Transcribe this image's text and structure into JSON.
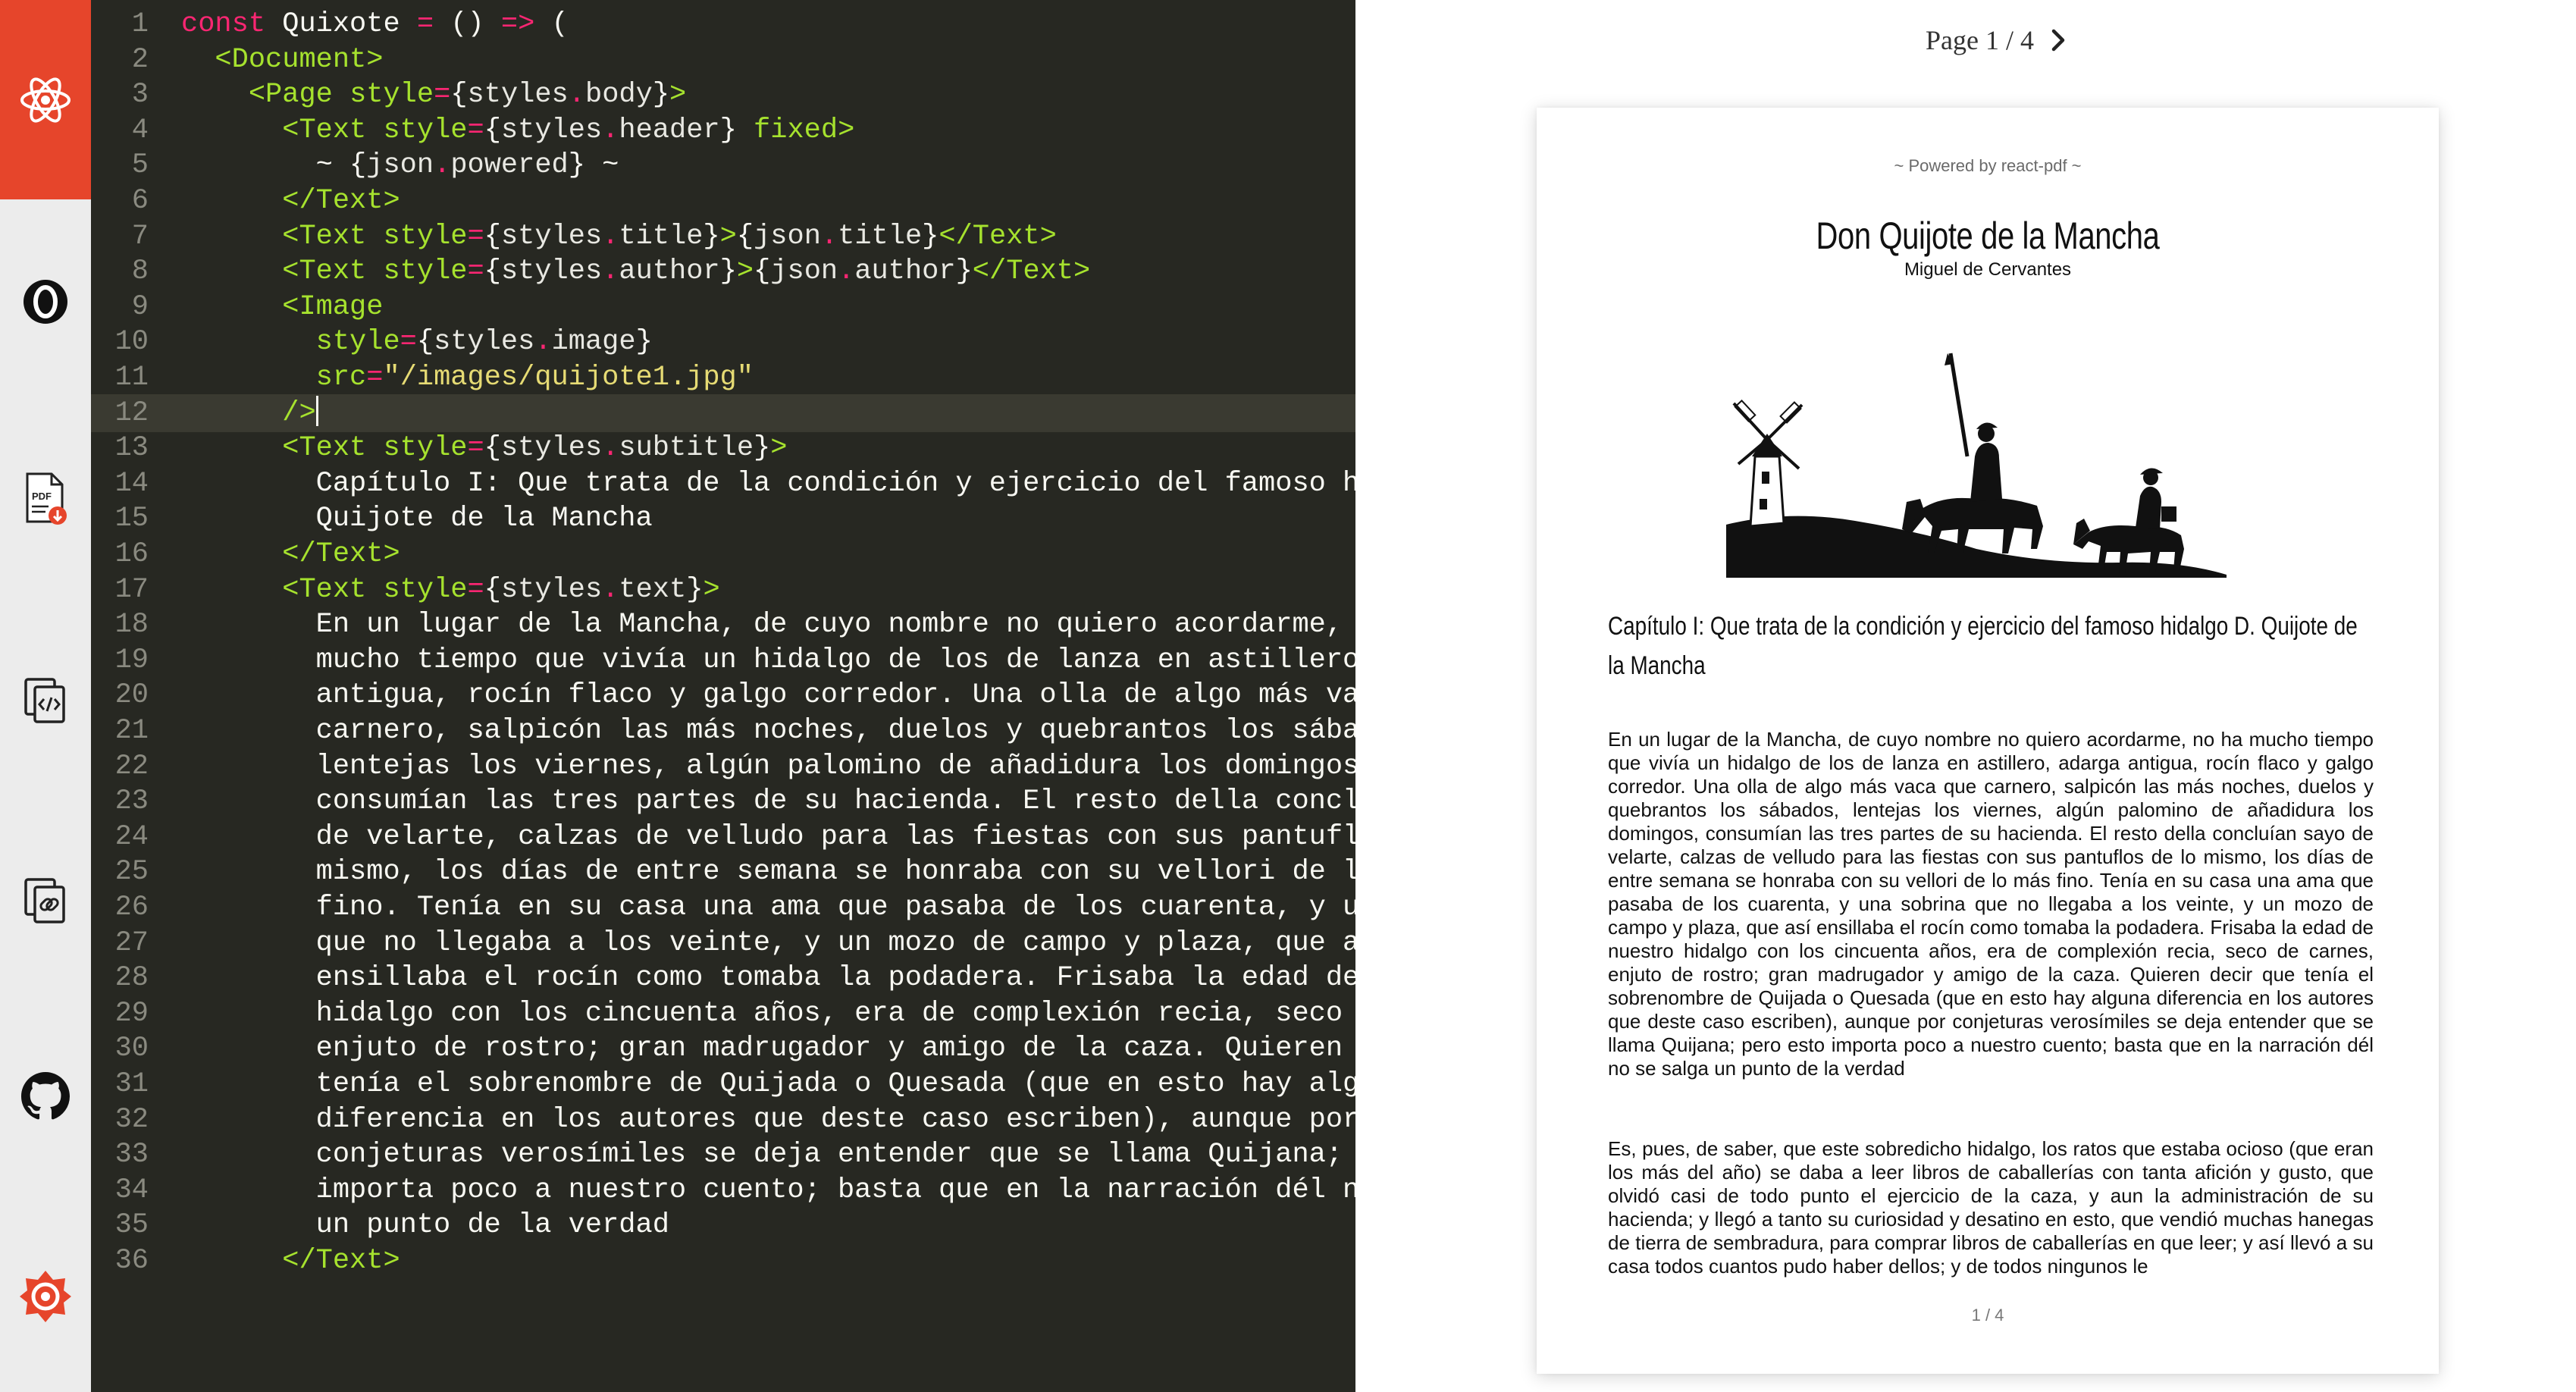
{
  "sidebar": {
    "items": [
      {
        "name": "react-logo",
        "icon": "react-icon"
      },
      {
        "name": "opencollective",
        "icon": "opencollective-icon"
      },
      {
        "name": "download-pdf",
        "icon": "pdf-download-icon"
      },
      {
        "name": "copy-code",
        "icon": "copy-code-icon"
      },
      {
        "name": "copy-link",
        "icon": "copy-link-icon"
      },
      {
        "name": "github",
        "icon": "github-icon"
      },
      {
        "name": "react-pdf-logo",
        "icon": "react-pdf-logo-icon"
      }
    ],
    "accent_color": "#e6452b"
  },
  "editor": {
    "active_line": 12,
    "lines": [
      {
        "n": "1",
        "t": [
          [
            "kw",
            "const"
          ],
          [
            "plain",
            " Quixote "
          ],
          [
            "op",
            "="
          ],
          [
            "plain",
            " () "
          ],
          [
            "op",
            "=>"
          ],
          [
            "plain",
            " ("
          ]
        ]
      },
      {
        "n": "2",
        "t": [
          [
            "plain",
            "  "
          ],
          [
            "tag",
            "<Document>"
          ]
        ]
      },
      {
        "n": "3",
        "t": [
          [
            "plain",
            "    "
          ],
          [
            "tag",
            "<Page "
          ],
          [
            "attr",
            "style"
          ],
          [
            "op",
            "="
          ],
          [
            "punc",
            "{"
          ],
          [
            "var",
            "styles"
          ],
          [
            "op",
            "."
          ],
          [
            "var",
            "body"
          ],
          [
            "punc",
            "}"
          ],
          [
            "tag",
            ">"
          ]
        ]
      },
      {
        "n": "4",
        "t": [
          [
            "plain",
            "      "
          ],
          [
            "tag",
            "<Text "
          ],
          [
            "attr",
            "style"
          ],
          [
            "op",
            "="
          ],
          [
            "punc",
            "{"
          ],
          [
            "var",
            "styles"
          ],
          [
            "op",
            "."
          ],
          [
            "var",
            "header"
          ],
          [
            "punc",
            "}"
          ],
          [
            "attr",
            " fixed"
          ],
          [
            "tag",
            ">"
          ]
        ]
      },
      {
        "n": "5",
        "t": [
          [
            "plain",
            "        ~ "
          ],
          [
            "punc",
            "{"
          ],
          [
            "var",
            "json"
          ],
          [
            "op",
            "."
          ],
          [
            "var",
            "powered"
          ],
          [
            "punc",
            "}"
          ],
          [
            "plain",
            " ~"
          ]
        ]
      },
      {
        "n": "6",
        "t": [
          [
            "plain",
            "      "
          ],
          [
            "tag",
            "</Text>"
          ]
        ]
      },
      {
        "n": "7",
        "t": [
          [
            "plain",
            "      "
          ],
          [
            "tag",
            "<Text "
          ],
          [
            "attr",
            "style"
          ],
          [
            "op",
            "="
          ],
          [
            "punc",
            "{"
          ],
          [
            "var",
            "styles"
          ],
          [
            "op",
            "."
          ],
          [
            "var",
            "title"
          ],
          [
            "punc",
            "}"
          ],
          [
            "tag",
            ">"
          ],
          [
            "punc",
            "{"
          ],
          [
            "var",
            "json"
          ],
          [
            "op",
            "."
          ],
          [
            "var",
            "title"
          ],
          [
            "punc",
            "}"
          ],
          [
            "tag",
            "</Text>"
          ]
        ]
      },
      {
        "n": "8",
        "t": [
          [
            "plain",
            "      "
          ],
          [
            "tag",
            "<Text "
          ],
          [
            "attr",
            "style"
          ],
          [
            "op",
            "="
          ],
          [
            "punc",
            "{"
          ],
          [
            "var",
            "styles"
          ],
          [
            "op",
            "."
          ],
          [
            "var",
            "author"
          ],
          [
            "punc",
            "}"
          ],
          [
            "tag",
            ">"
          ],
          [
            "punc",
            "{"
          ],
          [
            "var",
            "json"
          ],
          [
            "op",
            "."
          ],
          [
            "var",
            "author"
          ],
          [
            "punc",
            "}"
          ],
          [
            "tag",
            "</Text>"
          ]
        ]
      },
      {
        "n": "9",
        "t": [
          [
            "plain",
            "      "
          ],
          [
            "tag",
            "<Image"
          ]
        ]
      },
      {
        "n": "10",
        "t": [
          [
            "plain",
            "        "
          ],
          [
            "attr",
            "style"
          ],
          [
            "op",
            "="
          ],
          [
            "punc",
            "{"
          ],
          [
            "var",
            "styles"
          ],
          [
            "op",
            "."
          ],
          [
            "var",
            "image"
          ],
          [
            "punc",
            "}"
          ]
        ]
      },
      {
        "n": "11",
        "t": [
          [
            "plain",
            "        "
          ],
          [
            "attr",
            "src"
          ],
          [
            "op",
            "="
          ],
          [
            "str",
            "\"/images/quijote1.jpg\""
          ]
        ]
      },
      {
        "n": "12",
        "t": [
          [
            "plain",
            "      "
          ],
          [
            "tag",
            "/>"
          ]
        ]
      },
      {
        "n": "13",
        "t": [
          [
            "plain",
            "      "
          ],
          [
            "tag",
            "<Text "
          ],
          [
            "attr",
            "style"
          ],
          [
            "op",
            "="
          ],
          [
            "punc",
            "{"
          ],
          [
            "var",
            "styles"
          ],
          [
            "op",
            "."
          ],
          [
            "var",
            "subtitle"
          ],
          [
            "punc",
            "}"
          ],
          [
            "tag",
            ">"
          ]
        ]
      },
      {
        "n": "14",
        "t": [
          [
            "plain",
            "        Capítulo I: Que trata de la condición y ejercicio del famoso hid"
          ]
        ]
      },
      {
        "n": "15",
        "t": [
          [
            "plain",
            "        Quijote de la Mancha"
          ]
        ]
      },
      {
        "n": "16",
        "t": [
          [
            "plain",
            "      "
          ],
          [
            "tag",
            "</Text>"
          ]
        ]
      },
      {
        "n": "17",
        "t": [
          [
            "plain",
            "      "
          ],
          [
            "tag",
            "<Text "
          ],
          [
            "attr",
            "style"
          ],
          [
            "op",
            "="
          ],
          [
            "punc",
            "{"
          ],
          [
            "var",
            "styles"
          ],
          [
            "op",
            "."
          ],
          [
            "var",
            "text"
          ],
          [
            "punc",
            "}"
          ],
          [
            "tag",
            ">"
          ]
        ]
      },
      {
        "n": "18",
        "t": [
          [
            "plain",
            "        En un lugar de la Mancha, de cuyo nombre no quiero acordarme, no"
          ]
        ]
      },
      {
        "n": "19",
        "t": [
          [
            "plain",
            "        mucho tiempo que vivía un hidalgo de los de lanza en astillero,"
          ]
        ]
      },
      {
        "n": "20",
        "t": [
          [
            "plain",
            "        antigua, rocín flaco y galgo corredor. Una olla de algo más vaca"
          ]
        ]
      },
      {
        "n": "21",
        "t": [
          [
            "plain",
            "        carnero, salpicón las más noches, duelos y quebrantos los sábado"
          ]
        ]
      },
      {
        "n": "22",
        "t": [
          [
            "plain",
            "        lentejas los viernes, algún palomino de añadidura los domingos,"
          ]
        ]
      },
      {
        "n": "23",
        "t": [
          [
            "plain",
            "        consumían las tres partes de su hacienda. El resto della conclui"
          ]
        ]
      },
      {
        "n": "24",
        "t": [
          [
            "plain",
            "        de velarte, calzas de velludo para las fiestas con sus pantuflos"
          ]
        ]
      },
      {
        "n": "25",
        "t": [
          [
            "plain",
            "        mismo, los días de entre semana se honraba con su vellori de lo"
          ]
        ]
      },
      {
        "n": "26",
        "t": [
          [
            "plain",
            "        fino. Tenía en su casa una ama que pasaba de los cuarenta, y una"
          ]
        ]
      },
      {
        "n": "27",
        "t": [
          [
            "plain",
            "        que no llegaba a los veinte, y un mozo de campo y plaza, que así"
          ]
        ]
      },
      {
        "n": "28",
        "t": [
          [
            "plain",
            "        ensillaba el rocín como tomaba la podadera. Frisaba la edad de n"
          ]
        ]
      },
      {
        "n": "29",
        "t": [
          [
            "plain",
            "        hidalgo con los cincuenta años, era de complexión recia, seco de"
          ]
        ]
      },
      {
        "n": "30",
        "t": [
          [
            "plain",
            "        enjuto de rostro; gran madrugador y amigo de la caza. Quieren de"
          ]
        ]
      },
      {
        "n": "31",
        "t": [
          [
            "plain",
            "        tenía el sobrenombre de Quijada o Quesada (que en esto hay algun"
          ]
        ]
      },
      {
        "n": "32",
        "t": [
          [
            "plain",
            "        diferencia en los autores que deste caso escriben), aunque por"
          ]
        ]
      },
      {
        "n": "33",
        "t": [
          [
            "plain",
            "        conjeturas verosímiles se deja entender que se llama Quijana; pe"
          ]
        ]
      },
      {
        "n": "34",
        "t": [
          [
            "plain",
            "        importa poco a nuestro cuento; basta que en la narración dél no"
          ]
        ]
      },
      {
        "n": "35",
        "t": [
          [
            "plain",
            "        un punto de la verdad"
          ]
        ]
      },
      {
        "n": "36",
        "t": [
          [
            "plain",
            "      "
          ],
          [
            "tag",
            "</Text>"
          ]
        ]
      }
    ]
  },
  "preview": {
    "pager": {
      "label": "Page 1 / 4",
      "next_icon": "chevron-right-icon"
    },
    "page": {
      "header": "~ Powered by react-pdf ~",
      "title": "Don Quijote de la Mancha",
      "author": "Miguel de Cervantes",
      "image_icon": "windmill-riders-illustration",
      "subtitle": "Capítulo I: Que trata de la condición y ejercicio del famoso hidalgo D. Quijote de la Mancha",
      "paragraph1": "En un lugar de la Mancha, de cuyo nombre no quiero acordarme, no ha mucho tiempo que vivía un hidalgo de los de lanza en astillero, adarga antigua, rocín flaco y galgo corredor. Una olla de algo más vaca que carnero, salpicón las más noches, duelos y quebrantos los sábados, lentejas los viernes, algún palomino de añadidura los domingos, consumían las tres partes de su hacienda. El resto della concluían sayo de velarte, calzas de velludo para las fiestas con sus pantuflos de lo mismo, los días de entre semana se honraba con su vellori de lo más fino. Tenía en su casa una ama que pasaba de los cuarenta, y una sobrina que no llegaba a los veinte, y un mozo de campo y plaza, que así ensillaba el rocín como tomaba la podadera. Frisaba la edad de nuestro hidalgo con los cincuenta años, era de complexión recia, seco de carnes, enjuto de rostro; gran madrugador y amigo de la caza. Quieren decir que tenía el sobrenombre de Quijada o Quesada (que en esto hay alguna diferencia en los autores que deste caso escriben), aunque por conjeturas verosímiles se deja entender que se llama Quijana; pero esto importa poco a nuestro cuento; basta que en la narración dél no se salga un punto de la verdad",
      "paragraph2": "Es, pues, de saber, que este sobredicho hidalgo, los ratos que estaba ocioso (que eran los más del año) se daba a leer libros de caballerías con tanta afición y gusto, que olvidó casi de todo punto el ejercicio de la caza, y aun la administración de su hacienda; y llegó a tanto su curiosidad y desatino en esto, que vendió muchas hanegas de tierra de sembradura, para comprar libros de caballerías en que leer; y así llevó a su casa todos cuantos pudo haber dellos; y de todos ningunos le",
      "page_number": "1 / 4"
    }
  }
}
